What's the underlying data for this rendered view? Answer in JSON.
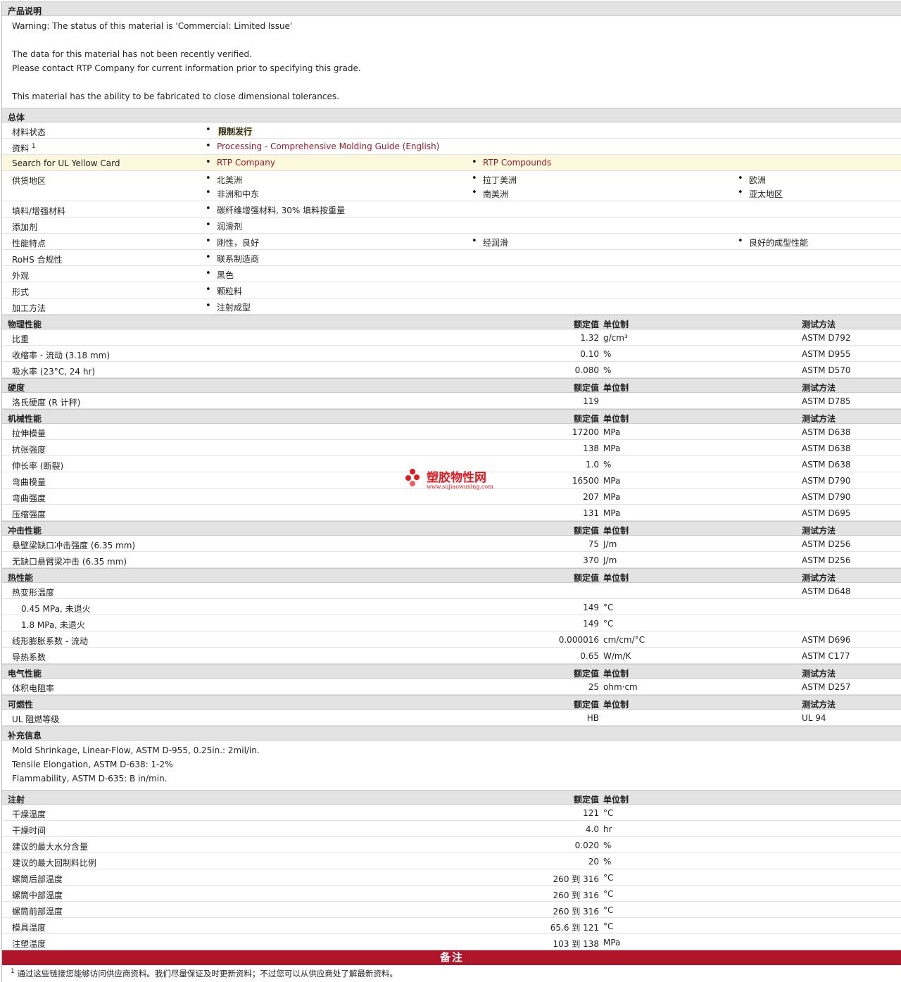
{
  "product_desc": {
    "title": "产品说明",
    "lines": [
      "Warning: The status of this material is 'Commercial: Limited Issue'",
      "The data for this material has not been recently verified.",
      "Please contact RTP Company for current information prior to specifying this grade.",
      "This material has the ability to be fabricated to close dimensional tolerances."
    ]
  },
  "general": {
    "title": "总体",
    "status_label": "材料状态",
    "status_value": "限制发行",
    "docs_label": "资料",
    "docs_sup": "1",
    "docs_link": "Processing - Comprehensive Molding Guide (English)",
    "ul_label": "Search for UL Yellow Card",
    "ul_link1": "RTP Company",
    "ul_link2": "RTP Compounds",
    "region_label": "供货地区",
    "regions": [
      "北美洲",
      "拉丁美洲",
      "欧洲",
      "非洲和中东",
      "南美洲",
      "亚太地区"
    ],
    "filler_label": "填料/增强材料",
    "filler_value": "碳纤维增强材料, 30% 填料按重量",
    "additive_label": "添加剂",
    "additive_value": "润滑剂",
    "features_label": "性能特点",
    "features": [
      "刚性，良好",
      "经润滑",
      "良好的成型性能"
    ],
    "rohs_label": "RoHS 合规性",
    "rohs_value": "联系制造商",
    "appearance_label": "外观",
    "appearance_value": "黑色",
    "form_label": "形式",
    "form_value": "颗粒料",
    "process_label": "加工方法",
    "process_value": "注射成型"
  },
  "headers": {
    "nominal": "额定值",
    "unit": "单位制",
    "method": "测试方法"
  },
  "physical": {
    "title": "物理性能",
    "rows": [
      {
        "label": "比重",
        "value": "1.32",
        "unit": "g/cm³",
        "method": "ASTM D792"
      },
      {
        "label": "收缩率  - 流动  (3.18 mm)",
        "value": "0.10",
        "unit": "%",
        "method": "ASTM D955"
      },
      {
        "label": "吸水率  (23°C, 24 hr)",
        "value": "0.080",
        "unit": "%",
        "method": "ASTM D570"
      }
    ]
  },
  "hardness": {
    "title": "硬度",
    "rows": [
      {
        "label": "洛氏硬度  (R 计秤)",
        "value": "119",
        "unit": "",
        "method": "ASTM D785"
      }
    ]
  },
  "mechanical": {
    "title": "机械性能",
    "rows": [
      {
        "label": "拉伸模量",
        "value": "17200",
        "unit": "MPa",
        "method": "ASTM D638"
      },
      {
        "label": "抗张强度",
        "value": "138",
        "unit": "MPa",
        "method": "ASTM D638"
      },
      {
        "label": "伸长率  (断裂)",
        "value": "1.0",
        "unit": "%",
        "method": "ASTM D638"
      },
      {
        "label": "弯曲模量",
        "value": "16500",
        "unit": "MPa",
        "method": "ASTM D790"
      },
      {
        "label": "弯曲强度",
        "value": "207",
        "unit": "MPa",
        "method": "ASTM D790"
      },
      {
        "label": "压缩强度",
        "value": "131",
        "unit": "MPa",
        "method": "ASTM D695"
      }
    ]
  },
  "impact": {
    "title": "冲击性能",
    "rows": [
      {
        "label": "悬壁梁缺口冲击强度  (6.35 mm)",
        "value": "75",
        "unit": "J/m",
        "method": "ASTM D256"
      },
      {
        "label": "无缺口悬臂梁冲击  (6.35 mm)",
        "value": "370",
        "unit": "J/m",
        "method": "ASTM D256"
      }
    ]
  },
  "thermal": {
    "title": "热性能",
    "rows": [
      {
        "label": "热变形温度",
        "value": "",
        "unit": "",
        "method": "ASTM D648"
      },
      {
        "label": "0.45 MPa, 未退火",
        "value": "149",
        "unit": "°C",
        "method": ""
      },
      {
        "label": "1.8 MPa, 未退火",
        "value": "149",
        "unit": "°C",
        "method": ""
      },
      {
        "label": "线形膨胀系数  - 流动",
        "value": "0.000016",
        "unit": "cm/cm/°C",
        "method": "ASTM D696"
      },
      {
        "label": "导热系数",
        "value": "0.65",
        "unit": "W/m/K",
        "method": "ASTM C177"
      }
    ]
  },
  "electrical": {
    "title": "电气性能",
    "rows": [
      {
        "label": "体积电阻率",
        "value": "25",
        "unit": "ohm·cm",
        "method": "ASTM D257"
      }
    ]
  },
  "flammability": {
    "title": "可燃性",
    "rows": [
      {
        "label": "UL 阻燃等级",
        "value": "HB",
        "unit": "",
        "method": "UL 94"
      }
    ]
  },
  "supplemental": {
    "title": "补充信息",
    "lines": [
      "Mold Shrinkage, Linear-Flow, ASTM D-955, 0.25in.: 2mil/in.",
      "Tensile Elongation, ASTM D-638: 1-2%",
      "Flammability, ASTM D-635: B in/min."
    ]
  },
  "injection": {
    "title": "注射",
    "rows": [
      {
        "label": "干燥温度",
        "value": "121",
        "unit": "°C"
      },
      {
        "label": "干燥时间",
        "value": "4.0",
        "unit": "hr"
      },
      {
        "label": "建议的最大水分含量",
        "value": "0.020",
        "unit": "%"
      },
      {
        "label": "建议的最大回制料比例",
        "value": "20",
        "unit": "%"
      },
      {
        "label": "螺筒后部温度",
        "value": "260 到  316",
        "unit": "°C"
      },
      {
        "label": "螺筒中部温度",
        "value": "260 到  316",
        "unit": "°C"
      },
      {
        "label": "螺筒前部温度",
        "value": "260 到  316",
        "unit": "°C"
      },
      {
        "label": "模具温度",
        "value": "65.6 到  121",
        "unit": "°C"
      },
      {
        "label": "注塑温度",
        "value": "103 到  138",
        "unit": "MPa"
      }
    ]
  },
  "notes": {
    "title": "备注",
    "footnote_num": "1",
    "footnote_text": "通过这些链接您能够访问供应商资料。我们尽量保证及时更新资料；不过您可以从供应商处了解最新资料。"
  },
  "watermark": {
    "name": "塑胶物性网",
    "url": "www.sujiaowuxing.com",
    "color": "#e2181e"
  },
  "colors": {
    "link": "#9a1a2b",
    "notes_bar": "#b0152a",
    "section_bg": "#e3e3e3",
    "highlight_bg": "#fcf8dd"
  }
}
